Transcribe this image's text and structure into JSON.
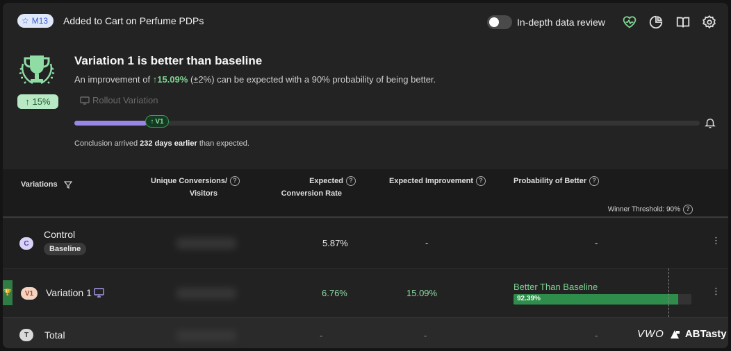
{
  "header": {
    "goal_badge": "M13",
    "goal_title": "Added to Cart on Perfume PDPs",
    "toggle_label": "In-depth data review",
    "toggle_on": false
  },
  "summary": {
    "improvement_pill": "↑ 15%",
    "headline": "Variation 1 is better than baseline",
    "sub_prefix": "An improvement of",
    "sub_value": "↑15.09%",
    "sub_suffix": "(±2%) can be expected with a 90% probability of being better.",
    "rollout_label": "Rollout Variation",
    "progress_fraction": 0.115,
    "marker_label": "V1",
    "conclusion_prefix": "Conclusion arrived",
    "conclusion_bold": "232 days earlier",
    "conclusion_suffix": "than expected."
  },
  "table": {
    "columns": {
      "variations": "Variations",
      "unique_conv_1": "Unique Conversions/",
      "unique_conv_2": "Visitors",
      "expected_1": "Expected",
      "expected_2": "Conversion Rate",
      "improvement": "Expected Improvement",
      "probability": "Probability of Better"
    },
    "winner_threshold": "Winner Threshold: 90%",
    "rows": {
      "control": {
        "tag": "C",
        "name": "Control",
        "badge": "Baseline",
        "rate": "5.87%",
        "improvement": "-",
        "probability": "-"
      },
      "variation": {
        "tag": "V1",
        "name": "Variation 1",
        "rate": "6.76%",
        "improvement": "15.09%",
        "probability_label": "Better Than Baseline",
        "probability_value": "92.39%",
        "probability_fraction": 0.9239
      },
      "total": {
        "tag": "T",
        "name": "Total",
        "rate": "-",
        "improvement": "-",
        "probability": "-"
      }
    }
  },
  "brand": {
    "left": "VWO",
    "right": "ABTasty"
  },
  "colors": {
    "accent_purple": "#9a86e6",
    "success_green": "#2f8d4b",
    "background": "#232323"
  }
}
